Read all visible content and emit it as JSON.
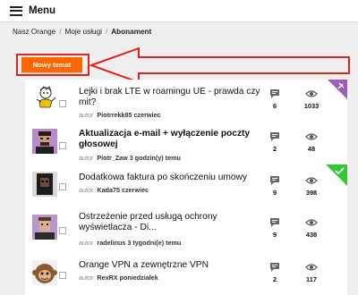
{
  "header": {
    "menu_label": "Menu"
  },
  "breadcrumb": {
    "items": [
      "Nasz Orange",
      "Moje usługi",
      "Abonament"
    ],
    "separator": "/"
  },
  "toolbar": {
    "new_topic_label": "Nowy temat"
  },
  "colors": {
    "accent": "#ff6600",
    "annotation": "#e2231a",
    "pinned_badge": "#9c5fb5",
    "solved_badge": "#32c832"
  },
  "topics": [
    {
      "title": "Lejki i brak LTE w roamingu UE - prawda czy mit?",
      "bold": false,
      "meta_prefix": "autor",
      "author": "Piotrrekk85",
      "date": "czerwiec",
      "replies": "6",
      "views": "1033",
      "badge": "pin-icon"
    },
    {
      "title": "Aktualizacja e-mail + wyłączenie poczty głosowej",
      "bold": true,
      "meta_prefix": "autor",
      "author": "Piotr_Zaw",
      "date": "3 godzin(y) temu",
      "replies": "2",
      "views": "48",
      "badge": ""
    },
    {
      "title": "Dodatkowa faktura po skończeniu umowy",
      "bold": false,
      "meta_prefix": "autor",
      "author": "Kada75",
      "date": "czerwiec",
      "replies": "9",
      "views": "398",
      "badge": "check-icon"
    },
    {
      "title": "Ostrzeżenie przed usługą ochrony wyświetlacza - Di...",
      "bold": false,
      "meta_prefix": "autor",
      "author": "radelinus",
      "date": "3 tygodni(e) temu",
      "replies": "9",
      "views": "438",
      "badge": ""
    },
    {
      "title": "Orange VPN a zewnętrzne VPN",
      "bold": false,
      "meta_prefix": "autor",
      "author": "RexRX",
      "date": "poniedziałek",
      "replies": "2",
      "views": "117",
      "badge": ""
    }
  ]
}
